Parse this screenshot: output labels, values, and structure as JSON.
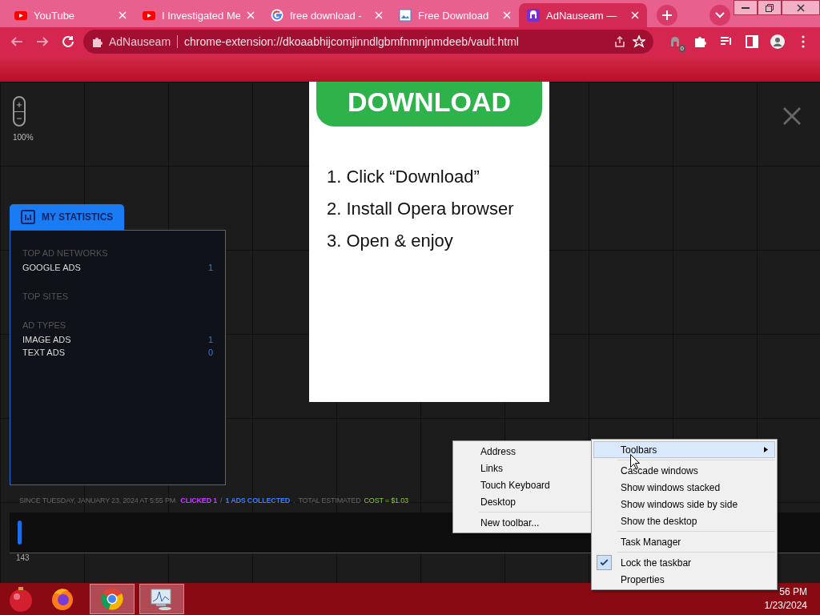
{
  "browser": {
    "tabs": [
      {
        "kind": "youtube",
        "title": "YouTube",
        "selected": false
      },
      {
        "kind": "youtube",
        "title": "I Investigated Me",
        "selected": false
      },
      {
        "kind": "google",
        "title": "free download -",
        "selected": false
      },
      {
        "kind": "image",
        "title": "Free Download",
        "selected": false
      },
      {
        "kind": "adnauseam",
        "title": "AdNauseam —",
        "selected": true
      }
    ],
    "address_bar": {
      "site": "AdNauseam",
      "url": "chrome-extension://dkoaabhijcomjinndlgbmfnmnjnmdeeb/vault.html"
    },
    "extension_badge": "0"
  },
  "vault": {
    "zoom_label": "100%",
    "statistics": {
      "title": "MY STATISTICS",
      "sections": [
        {
          "heading": "TOP AD NETWORKS",
          "rows": [
            {
              "label": "GOOGLE ADS",
              "value": "1"
            }
          ]
        },
        {
          "heading": "TOP SITES"
        },
        {
          "heading": "AD TYPES",
          "rows": [
            {
              "label": "IMAGE ADS",
              "value": "1"
            },
            {
              "label": "TEXT ADS",
              "value": "0"
            }
          ]
        }
      ]
    },
    "ad": {
      "button": "DOWNLOAD",
      "steps": [
        "1. Click “Download”",
        "2. Install Opera browser",
        "3. Open & enjoy"
      ]
    },
    "summary": {
      "since": "SINCE TUESDAY, JANUARY 23, 2024 AT 5:55 PM.",
      "clicked": "CLICKED 1",
      "slash": "/",
      "collected": "1 ADS COLLECTED",
      "period": ".",
      "total": "TOTAL ESTIMATED",
      "cost": "COST = $1.03"
    },
    "timeline": {
      "label": "143"
    }
  },
  "taskbar": {
    "apps": [
      {
        "kind": "firefox",
        "running": false
      },
      {
        "kind": "chrome",
        "running": true
      },
      {
        "kind": "monitor",
        "running": true
      }
    ],
    "clock": {
      "time": "56 PM",
      "date": "1/23/2024"
    }
  },
  "context_menu": {
    "items": [
      {
        "kind": "item",
        "label": "Toolbars",
        "submenu": true,
        "selected": true,
        "checked": false
      },
      {
        "kind": "separator"
      },
      {
        "kind": "item",
        "label": "Cascade windows",
        "submenu": false,
        "selected": false,
        "checked": false
      },
      {
        "kind": "item",
        "label": "Show windows stacked",
        "submenu": false,
        "selected": false,
        "checked": false
      },
      {
        "kind": "item",
        "label": "Show windows side by side",
        "submenu": false,
        "selected": false,
        "checked": false
      },
      {
        "kind": "item",
        "label": "Show the desktop",
        "submenu": false,
        "selected": false,
        "checked": false
      },
      {
        "kind": "separator"
      },
      {
        "kind": "item",
        "label": "Task Manager",
        "submenu": false,
        "selected": false,
        "checked": false
      },
      {
        "kind": "separator"
      },
      {
        "kind": "item",
        "label": "Lock the taskbar",
        "submenu": false,
        "selected": false,
        "checked": true
      },
      {
        "kind": "item",
        "label": "Properties",
        "submenu": false,
        "selected": false,
        "checked": false
      }
    ]
  },
  "toolbars_submenu": {
    "items": [
      {
        "kind": "item",
        "label": "Address"
      },
      {
        "kind": "item",
        "label": "Links"
      },
      {
        "kind": "item",
        "label": "Touch Keyboard"
      },
      {
        "kind": "item",
        "label": "Desktop"
      },
      {
        "kind": "separator"
      },
      {
        "kind": "item",
        "label": "New toolbar..."
      }
    ]
  }
}
